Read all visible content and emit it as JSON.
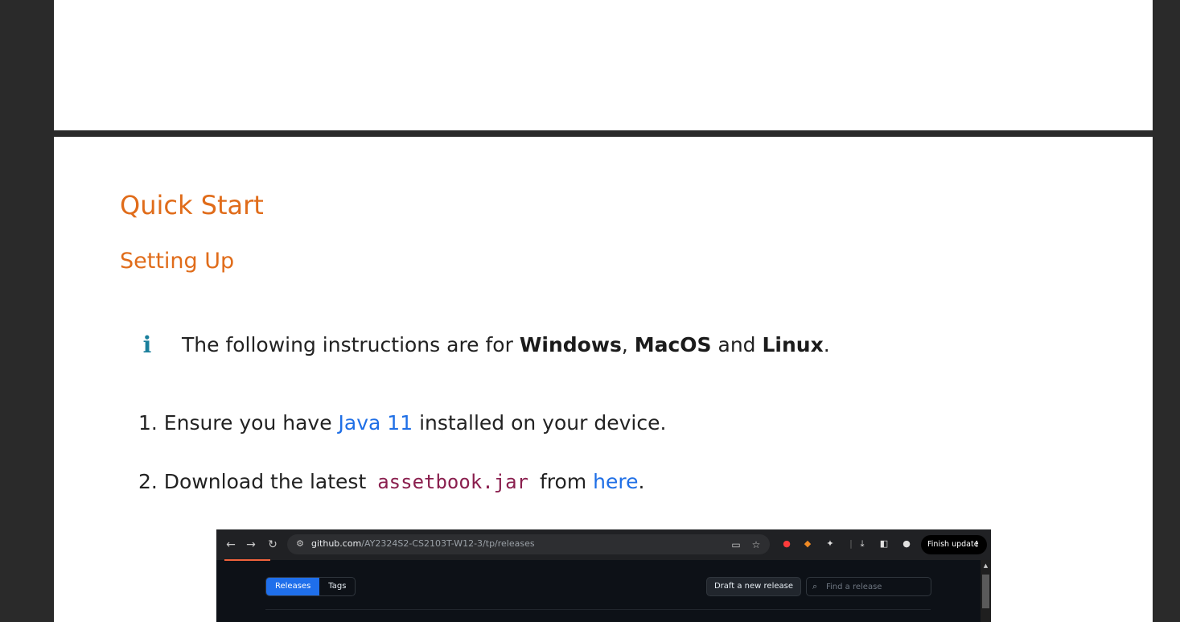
{
  "headings": {
    "title": "Quick Start",
    "subtitle": "Setting Up"
  },
  "info": {
    "icon": "info-icon",
    "prefix": "The following instructions are for ",
    "os1": "Windows",
    "sep1": ", ",
    "os2": "MacOS",
    "sep2": " and ",
    "os3": "Linux",
    "suffix": "."
  },
  "steps": {
    "step1": {
      "prefix": "1. Ensure you have ",
      "link": "Java 11",
      "suffix": " installed on your device."
    },
    "step2": {
      "prefix": "2. Download the latest ",
      "code": "assetbook.jar",
      "middle": " from ",
      "link": "here",
      "suffix": "."
    }
  },
  "browser": {
    "url_host": "github.com",
    "url_path": "/AY2324S2-CS2103T-W12-3/tp/releases",
    "finish_update": "Finish update",
    "tabs": [
      "Releases",
      "Tags"
    ],
    "draft_button": "Draft a new release",
    "find_placeholder": "Find a release"
  },
  "colors": {
    "heading": "#e06c1a",
    "link": "#1f6fe6",
    "code": "#8a1f4e",
    "info_icon": "#1a7f9c"
  }
}
